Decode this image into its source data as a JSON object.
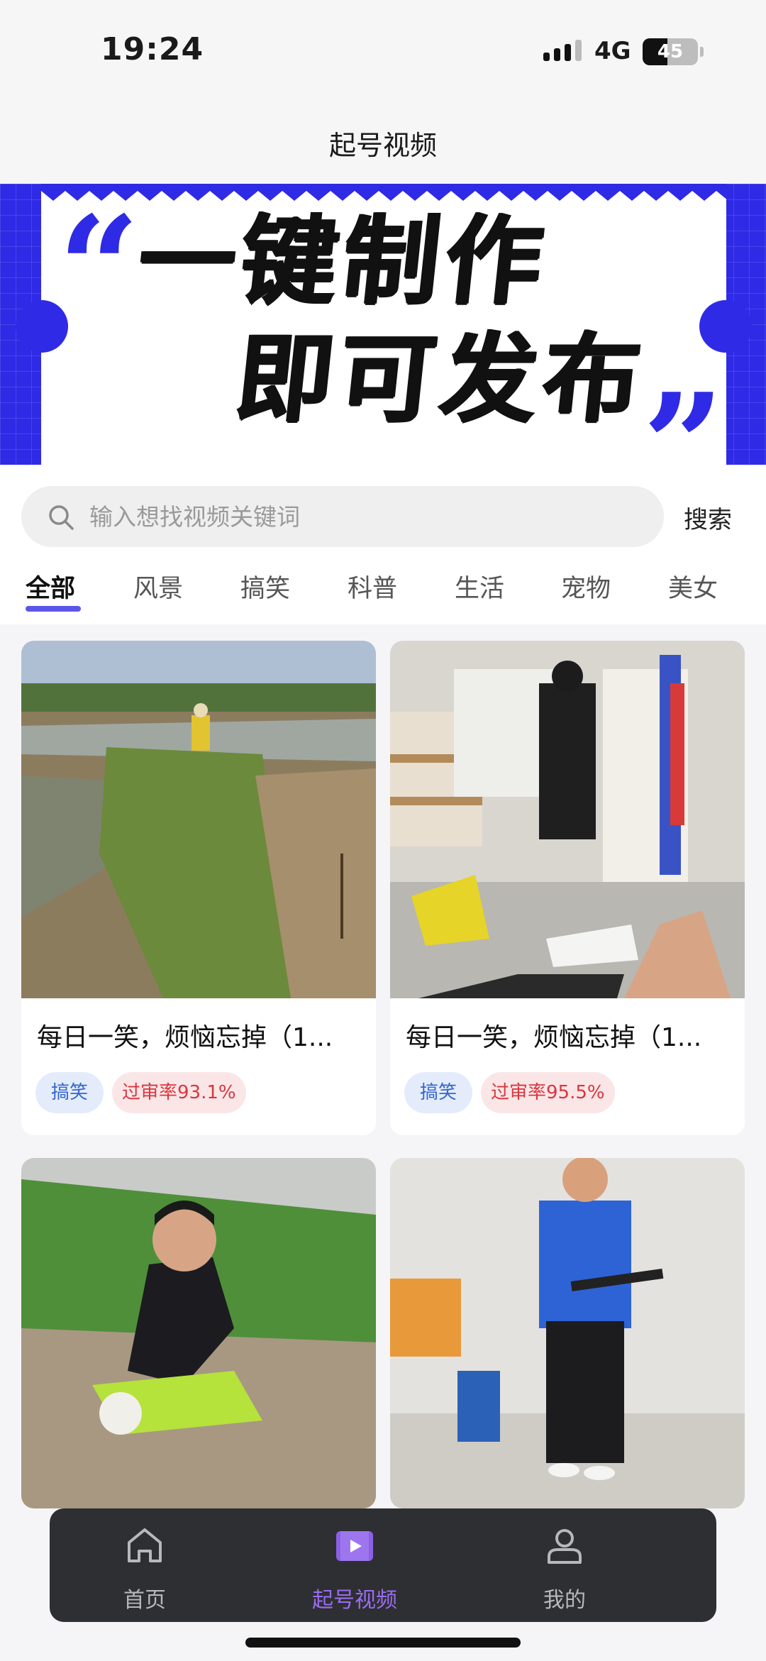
{
  "status_bar": {
    "time": "19:24",
    "network": "4G",
    "battery": "45",
    "battery_level": 0.45
  },
  "header": {
    "title": "起号视频"
  },
  "banner": {
    "line1": "一键制作",
    "line2": "即可发布",
    "quote_open": "“",
    "quote_close": "”",
    "accent_color": "#2f2ae6"
  },
  "search": {
    "placeholder": "输入想找视频关键词",
    "value": "",
    "button_label": "搜索"
  },
  "tabs": [
    {
      "label": "全部",
      "active": true
    },
    {
      "label": "风景"
    },
    {
      "label": "搞笑"
    },
    {
      "label": "科普"
    },
    {
      "label": "生活"
    },
    {
      "label": "宠物"
    },
    {
      "label": "美女"
    }
  ],
  "videos": [
    {
      "title": "每日一笑，烦恼忘掉（1...",
      "category": "搞笑",
      "pass_rate": "过审率93.1%"
    },
    {
      "title": "每日一笑，烦恼忘掉（1...",
      "category": "搞笑",
      "pass_rate": "过审率95.5%"
    },
    {
      "title": "",
      "category": "",
      "pass_rate": ""
    },
    {
      "title": "",
      "category": "",
      "pass_rate": ""
    }
  ],
  "bottom_nav": [
    {
      "label": "首页",
      "icon": "home-icon"
    },
    {
      "label": "起号视频",
      "icon": "video-icon",
      "active": true
    },
    {
      "label": "我的",
      "icon": "user-icon"
    }
  ],
  "colors": {
    "accent": "#5b57e6",
    "nav_active": "#9a6cf0",
    "tag_blue": "#3366cc",
    "tag_red": "#d9363e"
  }
}
